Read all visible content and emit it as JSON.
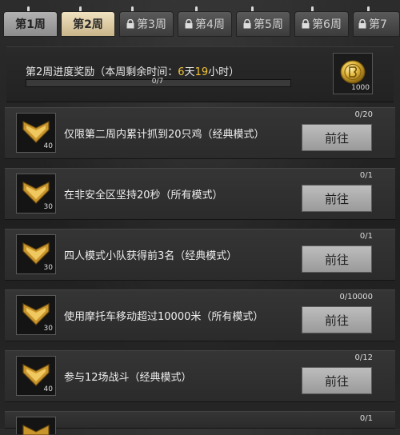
{
  "tabs": [
    {
      "label": "第1周",
      "locked": false
    },
    {
      "label": "第2周",
      "locked": false
    },
    {
      "label": "第3周",
      "locked": true
    },
    {
      "label": "第4周",
      "locked": true
    },
    {
      "label": "第5周",
      "locked": true
    },
    {
      "label": "第6周",
      "locked": true
    },
    {
      "label": "第7",
      "locked": true
    }
  ],
  "header": {
    "title_prefix": "第2周进度奖励（本周剩余时间：",
    "days": "6",
    "days_unit": "天",
    "hours": "19",
    "hours_unit": "小时）",
    "progress_text": "0/7",
    "progress_fraction": 0,
    "reward_amount": "1000"
  },
  "tasks": [
    {
      "desc": "仅限第二周内累计抓到20只鸡（经典模式）",
      "count": "0/20",
      "level": "40",
      "button": "前往"
    },
    {
      "desc": "在非安全区坚持20秒（所有模式）",
      "count": "0/1",
      "level": "30",
      "button": "前往"
    },
    {
      "desc": "四人模式小队获得前3名（经典模式）",
      "count": "0/1",
      "level": "30",
      "button": "前往"
    },
    {
      "desc": "使用摩托车移动超过10000米（所有模式）",
      "count": "0/10000",
      "level": "30",
      "button": "前往"
    },
    {
      "desc": "参与12场战斗（经典模式）",
      "count": "0/12",
      "level": "40",
      "button": "前往"
    },
    {
      "desc": "",
      "count": "0/1",
      "level": "",
      "button": ""
    }
  ],
  "colors": {
    "accent": "#f3c43a",
    "active_tab": "#e6d6ae",
    "button": "#b0b0b0"
  }
}
